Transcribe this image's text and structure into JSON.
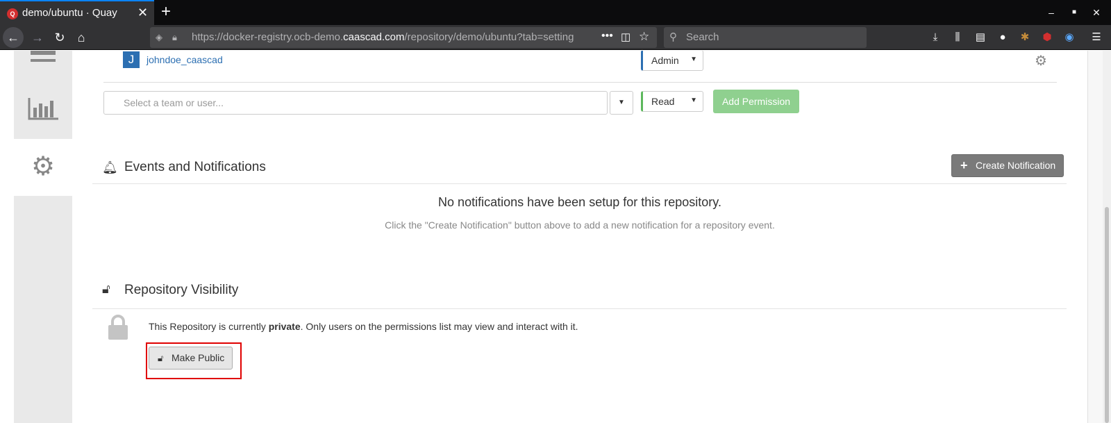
{
  "browser": {
    "tab_title": "demo/ubuntu · Quay",
    "url_prefix": "https://docker-registry.ocb-demo.",
    "url_host": "caascad.com",
    "url_path": "/repository/demo/ubuntu?tab=setting",
    "search_placeholder": "Search"
  },
  "permissions": {
    "user_initial": "J",
    "user_name": "johndoe_caascad",
    "user_role": "Admin",
    "entity_placeholder": "Select a team or user...",
    "new_role": "Read",
    "add_label": "Add Permission"
  },
  "notifications": {
    "title": "Events and Notifications",
    "create_label": "Create Notification",
    "empty_title": "No notifications have been setup for this repository.",
    "empty_subtitle": "Click the \"Create Notification\" button above to add a new notification for a repository event."
  },
  "visibility": {
    "title": "Repository Visibility",
    "text_before": "This Repository is currently ",
    "status": "private",
    "text_after": ". Only users on the permissions list may view and interact with it.",
    "button_label": "Make Public"
  },
  "colors": {
    "link": "#2c6fb2",
    "add_button": "#8fd08f",
    "highlight": "#e00000"
  }
}
